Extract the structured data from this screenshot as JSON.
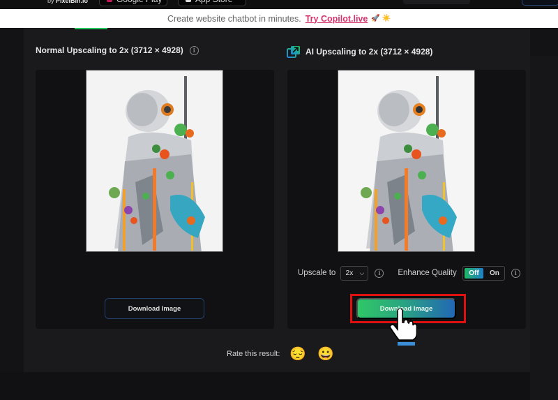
{
  "topbar": {
    "brand_prefix": "by",
    "brand_name": "PixelBin.io",
    "google_play_label": "Google Play",
    "app_store_label": "App Store"
  },
  "banner": {
    "text": "Create website chatbot in minutes.",
    "link_label": "Try Copilot.live",
    "emojis": "🚀 ☀️"
  },
  "normal_panel": {
    "title": "Normal Upscaling to 2x (3712 × 4928)",
    "info_icon": "info-icon",
    "image_alt": "Astronaut robot with flowers",
    "download_label": "Download Image"
  },
  "ai_panel": {
    "title": "AI Upscaling to 2x (3712 × 4928)",
    "image_alt": "Astronaut robot with flowers (AI upscaled)",
    "upscale_label": "Upscale to",
    "upscale_value": "2x",
    "enhance_label": "Enhance Quality",
    "enhance_options": [
      "Off",
      "On"
    ],
    "enhance_selected": "Off",
    "download_label": "Download Image"
  },
  "rating": {
    "label": "Rate this result:",
    "options": [
      "😔",
      "😀"
    ]
  },
  "colors": {
    "accent_green": "#22c55e",
    "accent_blue": "#2167b4",
    "link_pink": "#d6336c",
    "highlight_red": "#e01010"
  }
}
